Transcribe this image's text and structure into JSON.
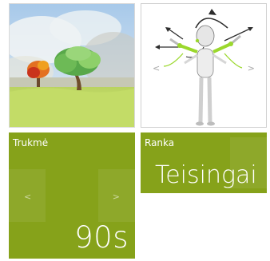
{
  "tiles": {
    "scene": {
      "image": "landscape-scene-image"
    },
    "figure": {
      "image": "skeleton-figure-image",
      "prev_arrow": "<",
      "next_arrow": ">"
    },
    "duration": {
      "label": "Trukmė",
      "value": "90s",
      "prev_arrow": "<",
      "next_arrow": ">"
    },
    "hand": {
      "label": "Ranka",
      "value": "Teisingai"
    }
  },
  "colors": {
    "tile_green": "#86a21a",
    "accent_lime": "#9bd82d",
    "arrow_dark": "#2d2d2d"
  }
}
